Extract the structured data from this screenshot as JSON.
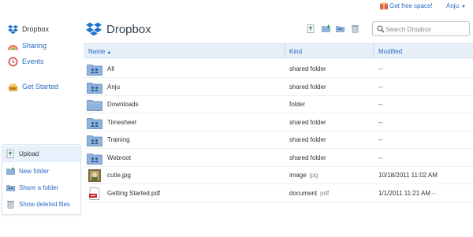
{
  "topbar": {
    "free_space_label": "Get free space!",
    "user_label": "Anju",
    "caret": "▼"
  },
  "sidebar": {
    "nav": [
      {
        "label": "Dropbox",
        "icon": "dropbox-icon"
      },
      {
        "label": "Sharing",
        "icon": "sharing-icon"
      },
      {
        "label": "Events",
        "icon": "events-icon"
      },
      {
        "label": "Get Started",
        "icon": "get-started-icon"
      }
    ],
    "actions": [
      {
        "label": "Upload",
        "icon": "upload-icon"
      },
      {
        "label": "New folder",
        "icon": "new-folder-icon"
      },
      {
        "label": "Share a folder",
        "icon": "share-folder-icon"
      },
      {
        "label": "Show deleted files",
        "icon": "show-deleted-icon"
      }
    ]
  },
  "header": {
    "title": "Dropbox",
    "search_placeholder": "Search Dropbox"
  },
  "table": {
    "columns": {
      "name": "Name",
      "kind": "Kind",
      "modified": "Modified"
    },
    "sort_indicator": "▲",
    "rows": [
      {
        "name": "All",
        "kind": "shared folder",
        "ext": "",
        "modified": "--",
        "ago": "",
        "icon": "shared-folder-icon"
      },
      {
        "name": "Anju",
        "kind": "shared folder",
        "ext": "",
        "modified": "--",
        "ago": "",
        "icon": "shared-folder-icon"
      },
      {
        "name": "Downloads",
        "kind": "folder",
        "ext": "",
        "modified": "--",
        "ago": "",
        "icon": "folder-icon"
      },
      {
        "name": "Timesheet",
        "kind": "shared folder",
        "ext": "",
        "modified": "--",
        "ago": "",
        "icon": "shared-folder-icon"
      },
      {
        "name": "Training",
        "kind": "shared folder",
        "ext": "",
        "modified": "--",
        "ago": "",
        "icon": "shared-folder-icon"
      },
      {
        "name": "Webroot",
        "kind": "shared folder",
        "ext": "",
        "modified": "--",
        "ago": "",
        "icon": "shared-folder-icon"
      },
      {
        "name": "cutie.jpg",
        "kind": "image",
        "ext": "jpg",
        "modified": "10/18/2011 11:02 AM",
        "ago": "",
        "icon": "image-thumbnail-icon"
      },
      {
        "name": "Getting Started.pdf",
        "kind": "document",
        "ext": "pdf",
        "modified": "1/1/2011 11:21 AM",
        "ago": "--",
        "icon": "pdf-icon"
      }
    ]
  },
  "colors": {
    "link": "#2a6bc4",
    "header_bg": "#e7eff8",
    "folder": "#8fb3dc",
    "accent": "#1f73c7"
  }
}
